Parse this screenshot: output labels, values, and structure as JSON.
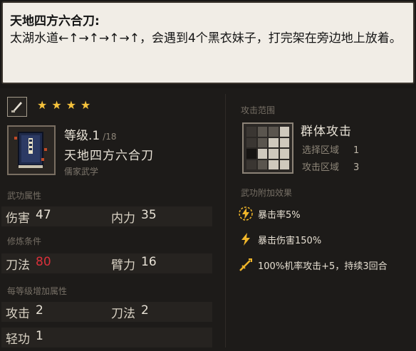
{
  "note": {
    "title": "天地四方六合刀:",
    "body": "太湖水道←↑→↑→↑→↑，会遇到4个黑衣妹子，打完架在旁边地上放着。"
  },
  "skill": {
    "stars": 4,
    "level_label": "等级.1",
    "level_max": "/18",
    "name": "天地四方六合刀",
    "school": "儒家武学"
  },
  "attributes": {
    "section_label": "武功属性",
    "damage_label": "伤害",
    "damage_value": "47",
    "inner_label": "内力",
    "inner_value": "35"
  },
  "requirements": {
    "section_label": "修炼条件",
    "blade_label": "刀法",
    "blade_value": "80",
    "arm_label": "臂力",
    "arm_value": "16"
  },
  "per_level": {
    "section_label": "每等级增加属性",
    "attack_label": "攻击",
    "attack_value": "2",
    "blade_label": "刀法",
    "blade_value": "2",
    "qinggong_label": "轻功",
    "qinggong_value": "1"
  },
  "range": {
    "section_label": "攻击范围",
    "type": "群体攻击",
    "select_label": "选择区域",
    "select_value": "1",
    "attack_area_label": "攻击区域",
    "attack_area_value": "3"
  },
  "effects": {
    "section_label": "武功附加效果",
    "items": [
      {
        "icon": "crit-rate-icon",
        "text": "暴击率5%"
      },
      {
        "icon": "crit-damage-icon",
        "text": "暴击伤害150%"
      },
      {
        "icon": "crossed-swords-icon",
        "text": "100%机率攻击+5，持续3回合"
      }
    ]
  },
  "colors": {
    "star": "#f5c23c",
    "warning": "#d8303a",
    "effect_icon": "#f0b62a"
  }
}
